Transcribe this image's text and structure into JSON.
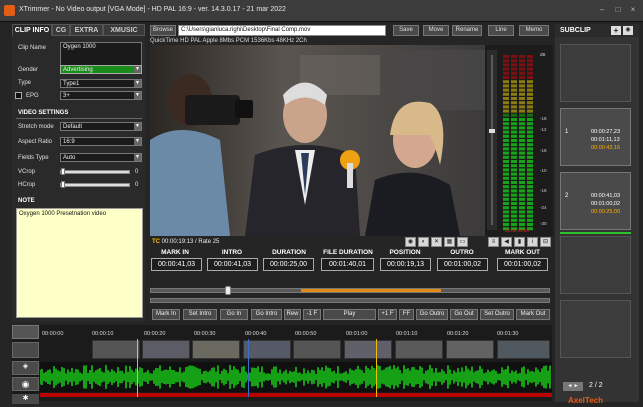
{
  "window": {
    "title": "XTrimmer - No Video output [VGA Mode] - HD PAL 16:9 - ver. 14.3.0.17 - 21 mar 2022"
  },
  "left_tabs": [
    "CLIP INFO",
    "CG",
    "EXTRA",
    "XMUSIC"
  ],
  "clip_info": {
    "clip_name_label": "Clip Name",
    "clip_name_value": "Oygen 1000",
    "gender_label": "Gender",
    "gender_value": "Advertising",
    "type_label": "Type",
    "type_value": "Type1",
    "epg_label": "EPG",
    "epg_value": "3+"
  },
  "video_settings": {
    "title": "VIDEO SETTINGS",
    "stretch_label": "Stretch mode",
    "stretch_value": "Default",
    "aspect_label": "Aspect Ratio",
    "aspect_value": "16:9",
    "fields_label": "Fields Type",
    "fields_value": "Auto",
    "vcrop_label": "VCrop",
    "vcrop_value": "0",
    "hcrop_label": "HCrop",
    "hcrop_value": "0"
  },
  "note": {
    "title": "NOTE",
    "text": "Oxygen 1000 Presetnation video"
  },
  "toolbar": {
    "browse": "Browse",
    "path": "C:\\Users\\gianluca.righi\\Desktop\\Final Comp.mov",
    "save": "Save",
    "move": "Move",
    "rename": "Rename",
    "line": "Line",
    "memo": "Memo"
  },
  "file_info": "QuickTime HD PAL  Apple 8Mbs PCM 1536Kbs 48KHz 2Ch",
  "timecode": {
    "tc_label": "TC",
    "tc_info": "00:00:19:13 / Rate 25"
  },
  "columns": [
    {
      "head": "MARK IN",
      "value": "00:00:41,03"
    },
    {
      "head": "INTRO",
      "value": "00:00:41,03"
    },
    {
      "head": "DURATION",
      "value": "00:00:25,00"
    },
    {
      "head": "FILE DURATION",
      "value": "00:01:40,01"
    },
    {
      "head": "POSITION",
      "value": "00:00:19,13"
    },
    {
      "head": "OUTRO",
      "value": "00:01:00,02"
    },
    {
      "head": "MARK OUT",
      "value": "00:01:00,02"
    }
  ],
  "transport": [
    "Mark In",
    "Set Intro",
    "Go In",
    "Go Intro",
    "Rew",
    "-1 F",
    "Play",
    "+1 F",
    "FF",
    "Go Outro",
    "Go Out",
    "Set Outro",
    "Mark Out"
  ],
  "timeline": {
    "ruler": [
      "00:00:00",
      "00:00:10",
      "00:00:20",
      "00:00:30",
      "00:00:40",
      "00:00:50",
      "00:01:00",
      "00:01:10",
      "00:01:20",
      "00:01:30"
    ]
  },
  "meter": {
    "labels": [
      "dB",
      "-18",
      "-12",
      "-18",
      "-10",
      "-18",
      "-24",
      "-30"
    ],
    "readout": "00:00  00:00"
  },
  "subclip": {
    "title": "SUBCLIP",
    "items": [
      {
        "index": "1",
        "tc1": "00:00:27,23",
        "tc2": "00:01:11,13",
        "tc3": "00:00:43,16"
      },
      {
        "index": "2",
        "tc1": "00:00:41,03",
        "tc2": "00:01:00,02",
        "tc3": "00:00:25,00"
      }
    ],
    "pager": "2 / 2",
    "logo": "AxelTech"
  },
  "colors": {
    "accent": "#e35d16",
    "green": "#00d000",
    "yellow_note": "#ffffc8",
    "orange_tc": "#ffb000"
  }
}
